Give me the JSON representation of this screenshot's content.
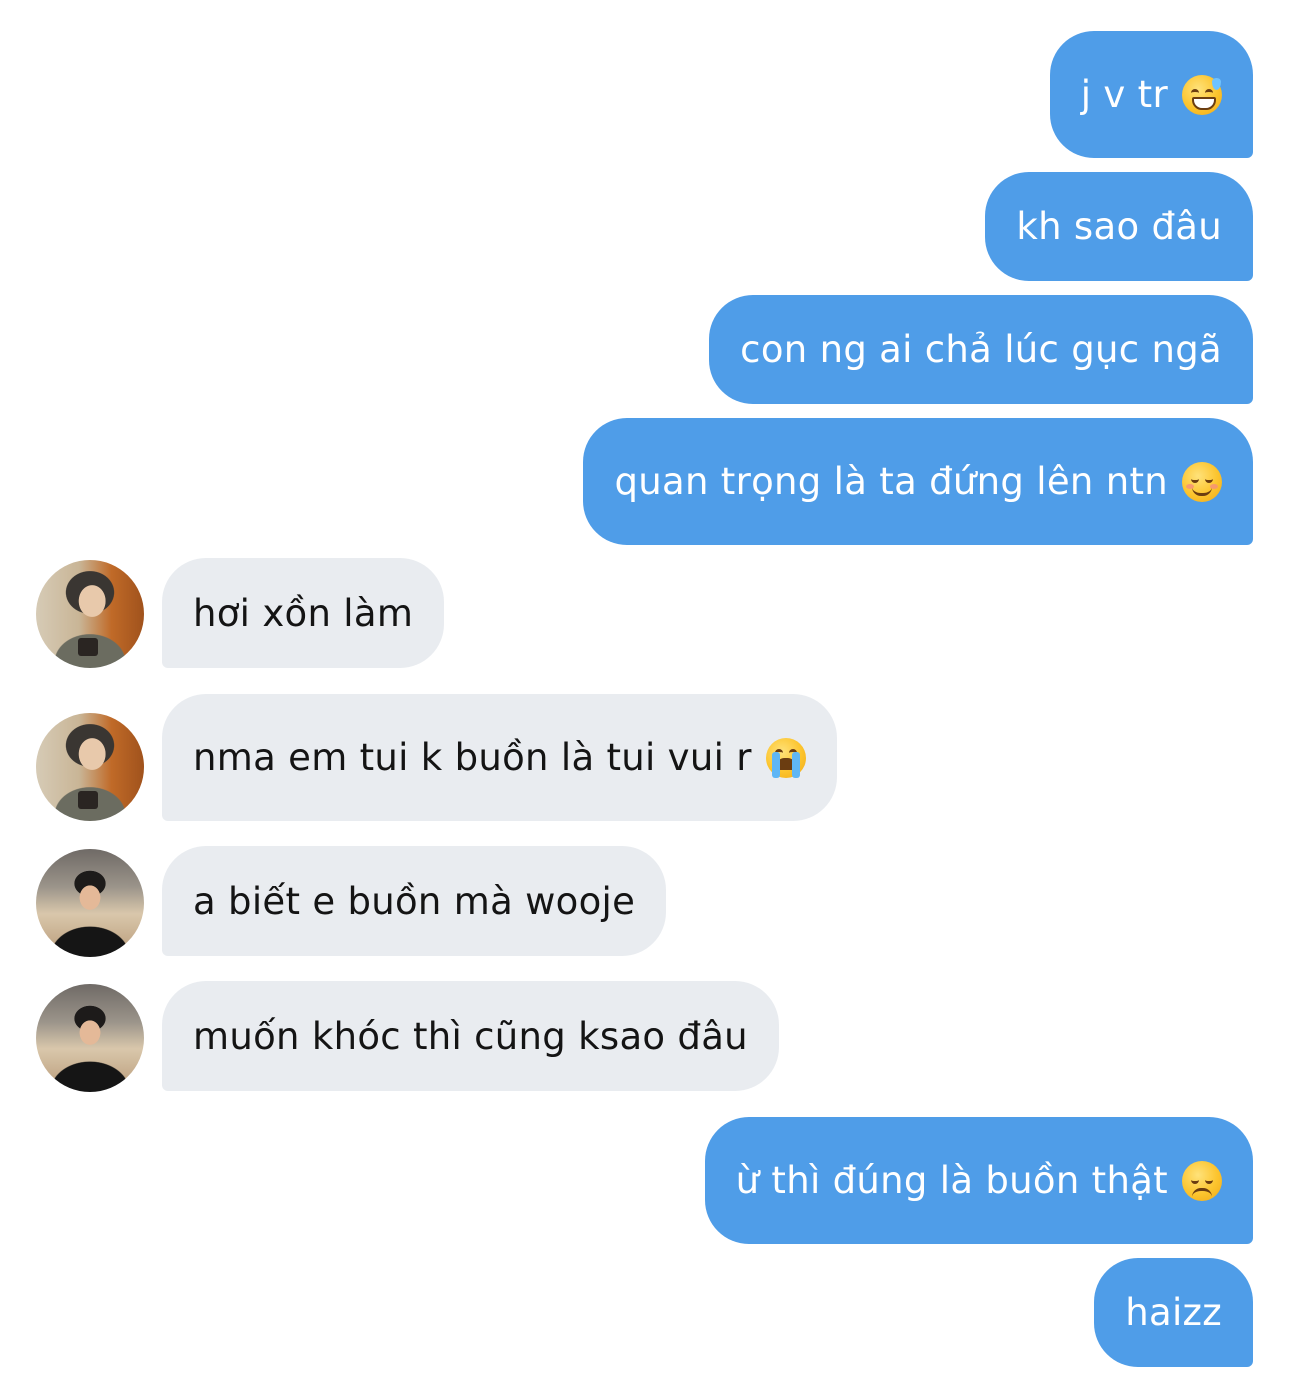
{
  "messages": [
    {
      "side": "sent",
      "text": "j v tr",
      "emoji": "grinning-sweat-emoji"
    },
    {
      "side": "sent",
      "text": "kh sao đâu"
    },
    {
      "side": "sent",
      "text": "con ng ai chả lúc gục ngã"
    },
    {
      "side": "sent",
      "text": "quan trọng là ta đứng lên ntn",
      "emoji": "relieved-face-emoji"
    },
    {
      "side": "received",
      "avatar": "contact-a-avatar",
      "text": "hơi xồn làm"
    },
    {
      "side": "received",
      "avatar": "contact-a-avatar",
      "text": "nma em tui k buồn là tui vui r",
      "emoji": "loudly-crying-emoji"
    },
    {
      "side": "received",
      "avatar": "contact-b-avatar",
      "text": "a biết e buồn mà wooje"
    },
    {
      "side": "received",
      "avatar": "contact-b-avatar",
      "text": "muốn khóc thì cũng ksao đâu"
    },
    {
      "side": "sent",
      "text": "ừ thì đúng là buồn thật",
      "emoji": "disappointed-face-emoji"
    },
    {
      "side": "sent",
      "text": "haizz"
    }
  ],
  "colors": {
    "sent_bubble": "#4f9de8",
    "received_bubble": "#e9ecf0",
    "background": "#ffffff"
  }
}
